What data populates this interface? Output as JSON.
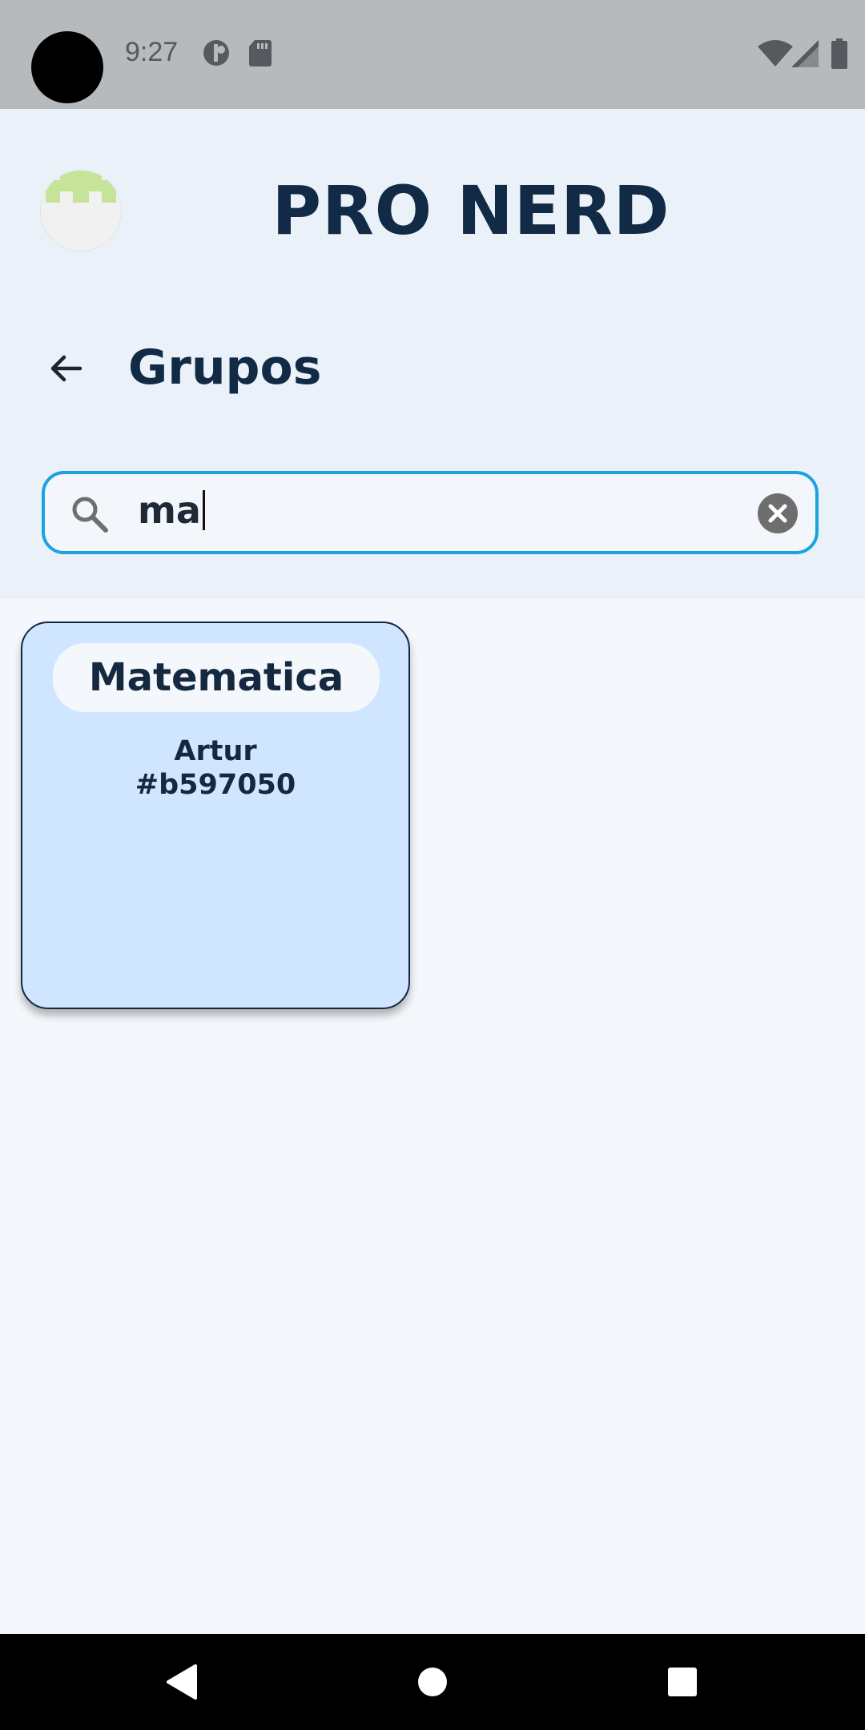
{
  "status_bar": {
    "time": "9:27",
    "icons": [
      "privacy-icon",
      "sd-card-icon",
      "wifi-icon",
      "cellular-signal-icon",
      "battery-icon"
    ]
  },
  "app": {
    "title": "PRO NERD",
    "avatar_icon": "pixel-invader-avatar-icon"
  },
  "page": {
    "title": "Grupos",
    "back_icon": "arrow-left-icon"
  },
  "search": {
    "value": "ma",
    "search_icon": "search-icon",
    "clear_icon": "clear-circle-icon"
  },
  "groups": [
    {
      "name": "Matematica",
      "owner": "Artur",
      "code": "#b597050"
    }
  ],
  "nav": {
    "back": "triangle-back-icon",
    "home": "circle-home-icon",
    "recents": "square-recents-icon"
  },
  "colors": {
    "primary_text": "#112a45",
    "search_border": "#1aa3e0",
    "card_background": "#d0e5ff",
    "header_background": "#eaf1f8",
    "page_background": "#f4f8fc"
  }
}
